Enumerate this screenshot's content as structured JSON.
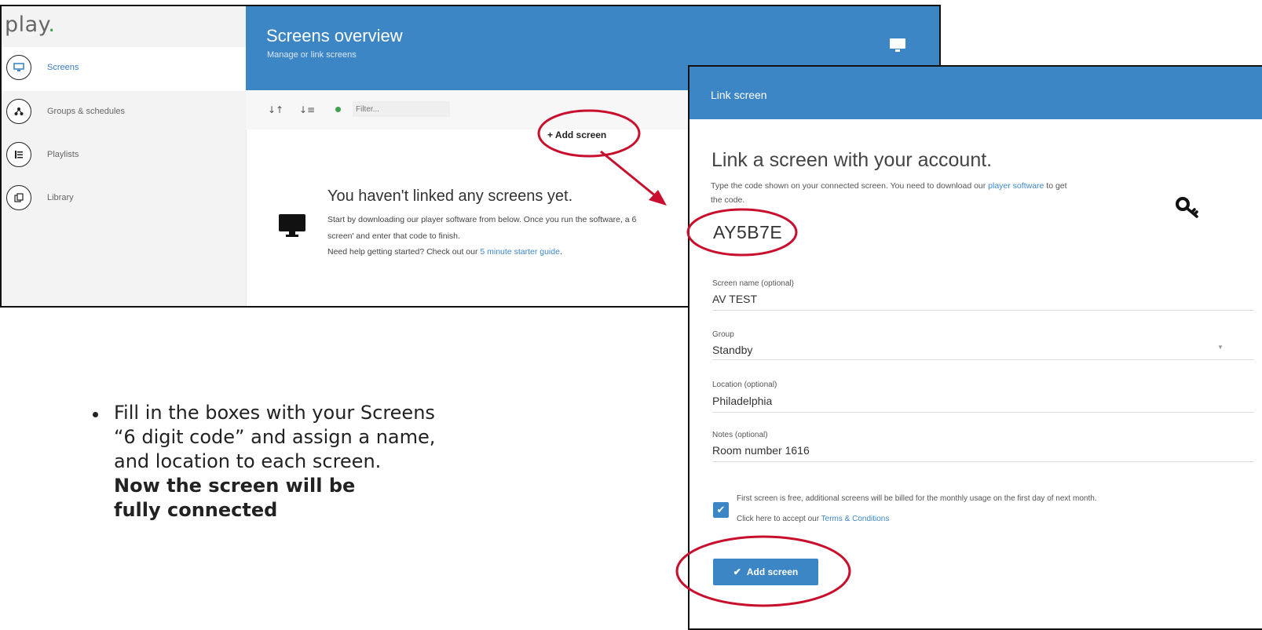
{
  "app": {
    "logo": "play",
    "logo_dot": "."
  },
  "sidebar": {
    "items": [
      {
        "label": "Screens",
        "icon": "monitor-icon",
        "active": true
      },
      {
        "label": "Groups & schedules",
        "icon": "hierarchy-icon",
        "active": false
      },
      {
        "label": "Playlists",
        "icon": "list-icon",
        "active": false
      },
      {
        "label": "Library",
        "icon": "files-icon",
        "active": false
      }
    ]
  },
  "header": {
    "title": "Screens overview",
    "subtitle": "Manage or link screens"
  },
  "toolbar": {
    "filter_placeholder": "Filter..."
  },
  "main": {
    "add_screen_label": "+ Add screen",
    "empty_title": "You haven't linked any screens yet.",
    "empty_line1": "Start by downloading our player software from below. Once you run the software, a 6",
    "empty_line2": "screen' and enter that code to finish.",
    "empty_line3_pre": "Need help getting started? Check out our ",
    "empty_line3_link": "5 minute starter guide",
    "empty_line3_post": "."
  },
  "dialog": {
    "title": "Link screen",
    "heading": "Link a screen with your account.",
    "desc_pre": "Type the code shown on your connected screen. You need to download our ",
    "desc_link": "player software",
    "desc_post": " to get",
    "desc_line2": "the code.",
    "code": "AY5B7E",
    "fields": {
      "name_label": "Screen name (optional)",
      "name_value": "AV TEST",
      "group_label": "Group",
      "group_value": "Standby",
      "location_label": "Location (optional)",
      "location_value": "Philadelphia",
      "notes_label": "Notes (optional)",
      "notes_value": "Room number 1616"
    },
    "checkbox_checked": true,
    "checkbox_text": "First screen is free, additional screens will be billed for the monthly usage on the first day of next month.",
    "terms_pre": "Click here to accept our ",
    "terms_link": "Terms & Conditions",
    "add_button": "Add screen"
  },
  "instructions": {
    "line1": "Fill in the boxes with your Screens",
    "line2": "“6 digit code” and assign a name,",
    "line3": "and location to each screen.",
    "bold1": "Now the screen will be",
    "bold2": "fully connected"
  },
  "colors": {
    "accent": "#3d86c6",
    "annotation": "#c8102e"
  }
}
